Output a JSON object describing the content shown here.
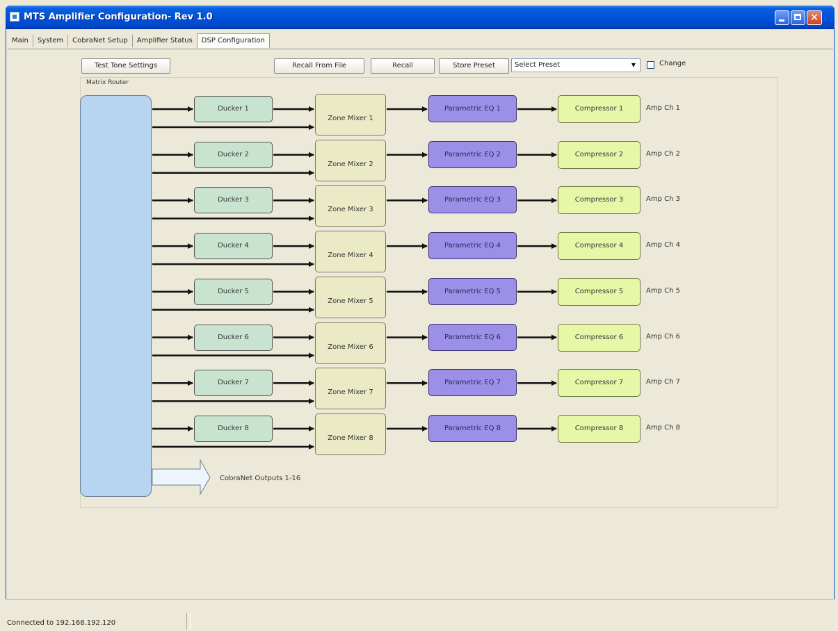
{
  "window": {
    "title": "MTS Amplifier Configuration- Rev 1.0"
  },
  "tabs": [
    {
      "label": "Main"
    },
    {
      "label": "System"
    },
    {
      "label": "CobraNet Setup"
    },
    {
      "label": "Amplifier Status"
    },
    {
      "label": "DSP Configuration",
      "active": true
    }
  ],
  "toolbar": {
    "test_tone": "Test Tone Settings",
    "recall_from_file": "Recall From File",
    "recall": "Recall",
    "store_preset": "Store Preset",
    "preset_select": "Select Preset",
    "change_label": "Change",
    "change_checked": false
  },
  "router": {
    "label": "Matrix Router",
    "outputs_label": "CobraNet Outputs 1-16"
  },
  "channels": [
    {
      "ducker": "Ducker 1",
      "mixer": "Zone Mixer 1",
      "eq": "Parametric EQ 1",
      "comp": "Compressor 1",
      "amp": "Amp Ch 1"
    },
    {
      "ducker": "Ducker 2",
      "mixer": "Zone Mixer 2",
      "eq": "Parametric EQ 2",
      "comp": "Compressor 2",
      "amp": "Amp Ch 2"
    },
    {
      "ducker": "Ducker 3",
      "mixer": "Zone Mixer 3",
      "eq": "Parametric EQ 3",
      "comp": "Compressor 3",
      "amp": "Amp Ch 3"
    },
    {
      "ducker": "Ducker 4",
      "mixer": "Zone Mixer 4",
      "eq": "Parametric EQ 4",
      "comp": "Compressor 4",
      "amp": "Amp Ch 4"
    },
    {
      "ducker": "Ducker 5",
      "mixer": "Zone Mixer 5",
      "eq": "Parametric EQ 5",
      "comp": "Compressor 5",
      "amp": "Amp Ch 5"
    },
    {
      "ducker": "Ducker 6",
      "mixer": "Zone Mixer 6",
      "eq": "Parametric EQ 6",
      "comp": "Compressor 6",
      "amp": "Amp Ch 6"
    },
    {
      "ducker": "Ducker 7",
      "mixer": "Zone Mixer 7",
      "eq": "Parametric EQ 7",
      "comp": "Compressor 7",
      "amp": "Amp Ch 7"
    },
    {
      "ducker": "Ducker 8",
      "mixer": "Zone Mixer 8",
      "eq": "Parametric EQ 8",
      "comp": "Compressor 8",
      "amp": "Amp Ch 8"
    }
  ],
  "colors": {
    "ducker": "#c8e3d0",
    "mixer": "#ebeac6",
    "eq": "#9b8fe8",
    "compressor": "#e6f7a8",
    "matrix": "#b7d4f0"
  },
  "status": {
    "connection": "Connected to 192.168.192.120"
  }
}
